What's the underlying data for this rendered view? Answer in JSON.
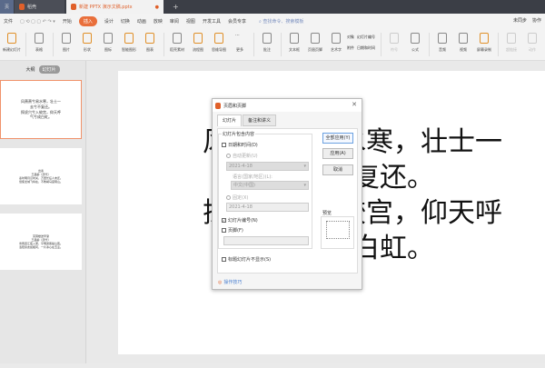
{
  "tabs": [
    {
      "label": "页"
    },
    {
      "label": "稻壳"
    },
    {
      "label": "新建 PPTX 演示文稿.pptx"
    }
  ],
  "menu": {
    "file": "文件",
    "items": [
      "开始",
      "插入",
      "设计",
      "切换",
      "动画",
      "放映",
      "审阅",
      "视图",
      "开发工具",
      "会员专享"
    ],
    "active": "插入",
    "search": "查找命令、搜索模板",
    "sync": "未同步",
    "collab": "协作"
  },
  "ribbon": [
    "新建幻灯片",
    "表格",
    "图片",
    "形状",
    "图标",
    "智能图形",
    "图表",
    "稻壳素材",
    "流程图",
    "思维导图",
    "更多",
    "批注",
    "文本框",
    "页眉页脚",
    "艺术字",
    "对象",
    "附件",
    "幻灯片编号",
    "日期和时间",
    "符号",
    "公式",
    "音频",
    "视频",
    "屏幕录制",
    "超链接",
    "动作"
  ],
  "left": {
    "outline": "大纲",
    "slides": "幻灯片"
  },
  "thumbs": [
    {
      "l1": "风萧萧兮易水寒，壮士一",
      "l2": "去兮不复还。",
      "l3": "探虎穴兮入蛟宫，仰天呼",
      "l4": "气兮成白虹。"
    },
    {
      "l1": "出塞",
      "l2": "王昌龄〔唐代〕",
      "l3": "秦时明月汉时关，万里长征人未还。",
      "l4": "但使龙城飞将在，不教胡马度阴山。"
    },
    {
      "l1": "芙蓉楼送辛渐",
      "l2": "王昌龄〔唐代〕",
      "l3": "寒雨连江夜入吴，平明送客楚山孤。",
      "l4": "洛阳亲友如相问，一片冰心在玉壶。"
    }
  ],
  "slide": {
    "l1": "风萧萧兮易水寒，壮士一",
    "l2": "去兮不复还。",
    "l3": "探虎穴兮入蛟宫，仰天呼",
    "l4": "气兮成白虹。"
  },
  "dialog": {
    "title": "页眉和页脚",
    "tab1": "幻灯片",
    "tab2": "备注和讲义",
    "group": "幻灯片包含内容",
    "datetime": "日期和时间(D)",
    "auto": "自动更新(U)",
    "auto_value": "2021-4-18",
    "lang_label": "语言(国家/地区)(L):",
    "lang": "中文(中国)",
    "fixed": "固定(X)",
    "fixed_value": "2021-4-18",
    "slidenum": "幻灯片编号(N)",
    "slidenum_checked": true,
    "footer": "页脚(F)",
    "hide_title": "标题幻灯片不显示(S)",
    "apply_all": "全部应用(Y)",
    "apply": "应用(A)",
    "cancel": "取消",
    "preview": "预览",
    "tips": "操作技巧"
  }
}
